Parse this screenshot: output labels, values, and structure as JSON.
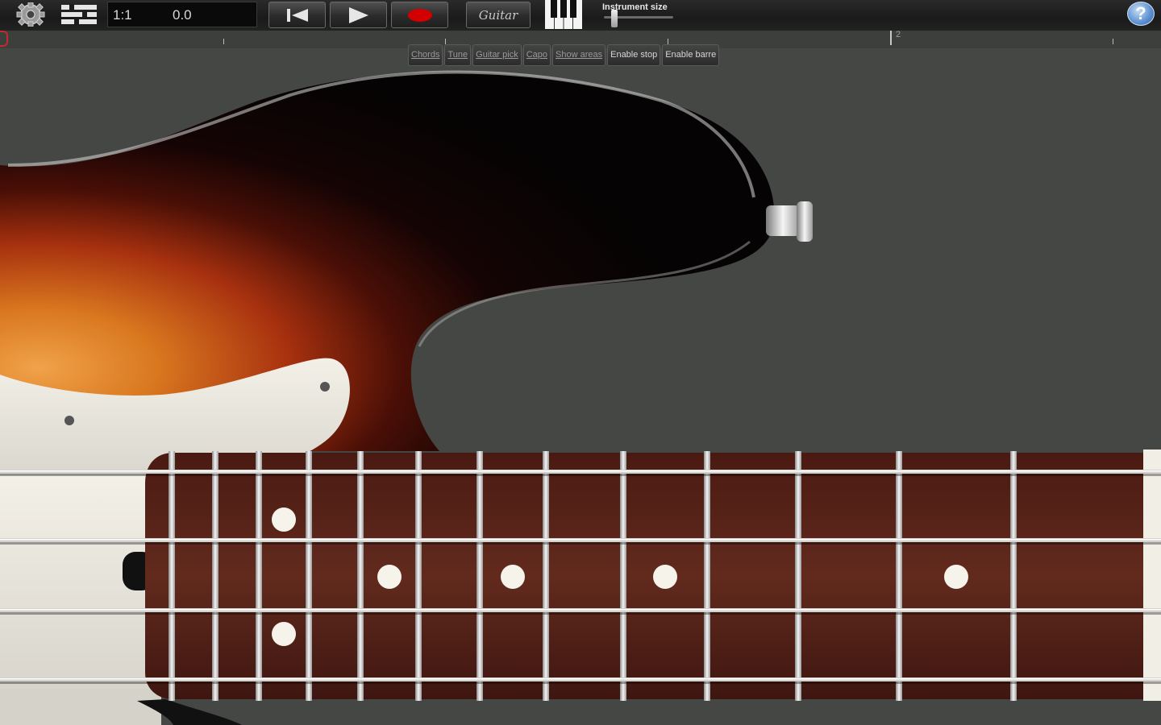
{
  "toolbar": {
    "position": "1:1",
    "time": "0.0",
    "instrument_button_label": "Guitar",
    "instrument_size_label": "Instrument size",
    "instrument_size_level": 0.12,
    "help_label": "?"
  },
  "timeline": {
    "bar_marker_label": "2"
  },
  "options": [
    {
      "label": "Chords",
      "active": false
    },
    {
      "label": "Tune",
      "active": false
    },
    {
      "label": "Guitar pick",
      "active": false
    },
    {
      "label": "Capo",
      "active": false
    },
    {
      "label": "Show areas",
      "active": false
    },
    {
      "label": "Enable stop",
      "active": true
    },
    {
      "label": "Enable barre",
      "active": true
    }
  ],
  "colors": {
    "accent_red": "#d40000",
    "background": "#454744",
    "fretboard": "#5a241a"
  },
  "icons": [
    "gear-icon",
    "mixer-icon",
    "rewind-icon",
    "play-icon",
    "record-icon",
    "piano-keyboard-icon",
    "help-icon"
  ],
  "instrument": {
    "type": "bass guitar",
    "strings": 4,
    "fret_markers": [
      3,
      5,
      7,
      9,
      12
    ]
  }
}
